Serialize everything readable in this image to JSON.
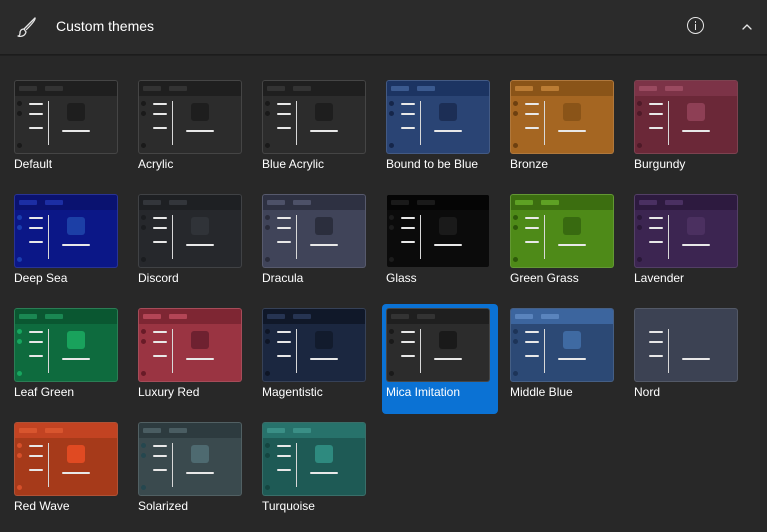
{
  "header": {
    "title": "Custom themes",
    "icons": [
      "paintbrush-icon",
      "info-icon",
      "chevron-up-icon"
    ]
  },
  "themes": [
    {
      "name": "Default",
      "colors": {
        "bg": "#2c2c2c",
        "bar": "#1f1f1f",
        "pill": "#333333",
        "dot": "#1a1a1a",
        "square": "#1e1e1e"
      }
    },
    {
      "name": "Acrylic",
      "colors": {
        "bg": "#2c2c2c",
        "bar": "#1f1f1f",
        "pill": "#333333",
        "dot": "#1a1a1a",
        "square": "#1e1e1e"
      }
    },
    {
      "name": "Blue Acrylic",
      "colors": {
        "bg": "#2c2c2c",
        "bar": "#1f1f1f",
        "pill": "#333333",
        "dot": "#1a1a1a",
        "square": "#1e1e1e"
      }
    },
    {
      "name": "Bound to be Blue",
      "colors": {
        "bg": "#2a4474",
        "bar": "#1c3462",
        "pill": "#3b5a8f",
        "dot": "#15264a",
        "square": "#1c2e55"
      }
    },
    {
      "name": "Bronze",
      "colors": {
        "bg": "#a56622",
        "bar": "#8a5418",
        "pill": "#bb7c34",
        "dot": "#6e4010",
        "square": "#8a5418"
      }
    },
    {
      "name": "Burgundy",
      "colors": {
        "bg": "#6b2838",
        "bar": "#7c3347",
        "pill": "#9a4a60",
        "dot": "#4e1a28",
        "square": "#8e3f55"
      }
    },
    {
      "name": "Deep Sea",
      "colors": {
        "bg": "#0b1787",
        "bar": "#0a1270",
        "pill": "#1c2ea3",
        "dot": "#1a3db0",
        "square": "#1c3fa6"
      }
    },
    {
      "name": "Discord",
      "colors": {
        "bg": "#26282c",
        "bar": "#1e2023",
        "pill": "#33363b",
        "dot": "#1b1d20",
        "square": "#303338"
      }
    },
    {
      "name": "Dracula",
      "colors": {
        "bg": "#404459",
        "bar": "#2e3142",
        "pill": "#4d5168",
        "dot": "#2a2c3b",
        "square": "#2b2e3d"
      }
    },
    {
      "name": "Glass",
      "colors": {
        "bg": "#0b0b0b",
        "bar": "#050505",
        "pill": "#1a1a1a",
        "dot": "#1c1c1c",
        "square": "#1a1a1a"
      }
    },
    {
      "name": "Green Grass",
      "colors": {
        "bg": "#4e8a18",
        "bar": "#3c6e10",
        "pill": "#5ea124",
        "dot": "#2e5a0a",
        "square": "#386a10"
      }
    },
    {
      "name": "Lavender",
      "colors": {
        "bg": "#3c2551",
        "bar": "#2d1a3f",
        "pill": "#4a3062",
        "dot": "#2a1839",
        "square": "#4b3060"
      }
    },
    {
      "name": "Leaf Green",
      "colors": {
        "bg": "#0e6b3e",
        "bar": "#0a5731",
        "pill": "#1a8752",
        "dot": "#17a65f",
        "square": "#19a25c"
      }
    },
    {
      "name": "Luxury Red",
      "colors": {
        "bg": "#9a3442",
        "bar": "#7e2633",
        "pill": "#b34556",
        "dot": "#681b27",
        "square": "#6e2130"
      }
    },
    {
      "name": "Magentistic",
      "colors": {
        "bg": "#1b2740",
        "bar": "#101829",
        "pill": "#263452",
        "dot": "#0f1626",
        "square": "#121b2d"
      }
    },
    {
      "name": "Mica Imitation",
      "colors": {
        "bg": "#2c2c2c",
        "bar": "#1f1f1f",
        "pill": "#333333",
        "dot": "#1a1a1a",
        "square": "#1a1a1a"
      }
    },
    {
      "name": "Middle Blue",
      "colors": {
        "bg": "#2c4975",
        "bar": "#3c659e",
        "pill": "#5a84bd",
        "dot": "#1d3458",
        "square": "#3f6aa2"
      }
    },
    {
      "name": "Nord",
      "colors": {
        "bg": "#3c4253",
        "bar": "#3c4253",
        "pill": "#3c4253",
        "dot": "#3c4253",
        "square": "#3c4253"
      }
    },
    {
      "name": "Red Wave",
      "colors": {
        "bg": "#a63a1a",
        "bar": "#c24322",
        "pill": "#d8552e",
        "dot": "#d6502a",
        "square": "#e04a22"
      }
    },
    {
      "name": "Solarized",
      "colors": {
        "bg": "#3a4a4e",
        "bar": "#2d3b3f",
        "pill": "#4a5d62",
        "dot": "#25474f",
        "square": "#4e6a70"
      }
    },
    {
      "name": "Turquoise",
      "colors": {
        "bg": "#1e5a55",
        "bar": "#27726b",
        "pill": "#3a8f86",
        "dot": "#144641",
        "square": "#2e8a7f"
      }
    }
  ],
  "selected_theme": "Mica Imitation"
}
